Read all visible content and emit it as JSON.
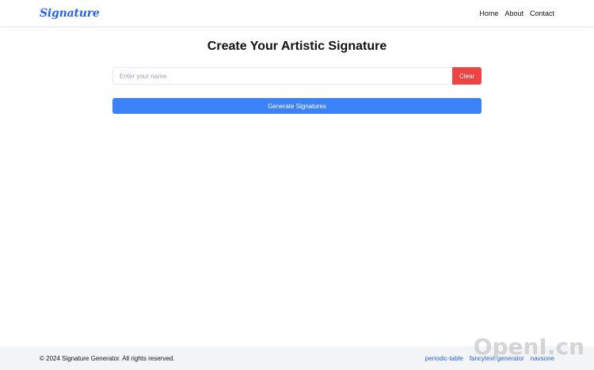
{
  "header": {
    "logo": "Signature",
    "nav": [
      "Home",
      "About",
      "Contact"
    ]
  },
  "main": {
    "title": "Create Your Artistic Signature",
    "name_input": {
      "placeholder": "Enter your name",
      "value": ""
    },
    "clear_label": "Clear",
    "generate_label": "Generate Signatures"
  },
  "footer": {
    "copyright": "© 2024 Signature Generator. All rights reserved.",
    "links": [
      "periodic-table",
      "fancytext-generator",
      "navsone"
    ]
  },
  "watermark": "OpenI.cn",
  "colors": {
    "brand": "#2563eb",
    "clear_button": "#ef4444",
    "generate_button": "#3b82f6",
    "footer_bg": "#f3f4f6"
  }
}
